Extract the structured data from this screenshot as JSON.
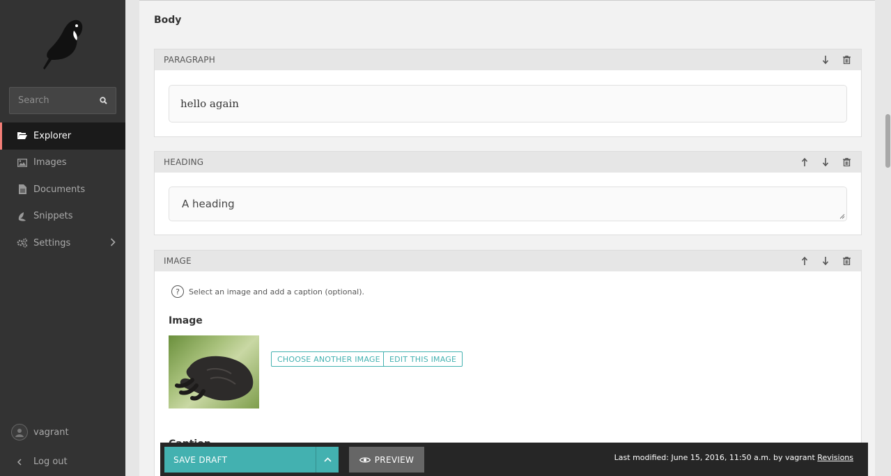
{
  "sidebar": {
    "search_placeholder": "Search",
    "items": [
      {
        "label": "Explorer",
        "icon": "folder-open-icon",
        "active": true
      },
      {
        "label": "Images",
        "icon": "image-icon"
      },
      {
        "label": "Documents",
        "icon": "doc-icon"
      },
      {
        "label": "Snippets",
        "icon": "snippet-icon"
      },
      {
        "label": "Settings",
        "icon": "cogs-icon"
      }
    ],
    "user": "vagrant",
    "logout": "Log out"
  },
  "editor": {
    "section_label": "Body",
    "blocks": [
      {
        "type": "PARAGRAPH",
        "value": "hello again"
      },
      {
        "type": "HEADING",
        "value": "A heading"
      },
      {
        "type": "IMAGE",
        "help": "Select an image and add a caption (optional).",
        "field_label": "Image",
        "choose_label": "CHOOSE ANOTHER IMAGE",
        "edit_label": "EDIT THIS IMAGE",
        "caption_label": "Caption"
      }
    ]
  },
  "footer": {
    "save_label": "SAVE DRAFT",
    "preview_label": "PREVIEW",
    "modified": "Last modified: June 15, 2016, 11:50 a.m. by vagrant",
    "revisions": "Revisions"
  },
  "colors": {
    "accent": "#43b1b0",
    "active_marker": "#f37e77",
    "sidebar": "#333333"
  }
}
